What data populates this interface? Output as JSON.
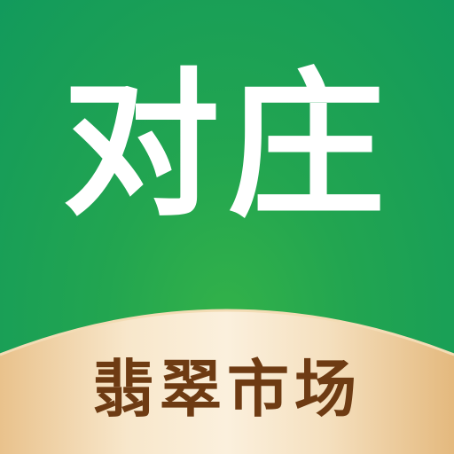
{
  "app_icon": {
    "brand_text": "对庄",
    "tagline_text": "翡翠市场"
  },
  "colors": {
    "background_green": "#1aa158",
    "brand_white": "#ffffff",
    "banner_cream": "#f6e3c4",
    "banner_gold": "#e8c08a",
    "tagline_brown": "#6e3b13"
  }
}
